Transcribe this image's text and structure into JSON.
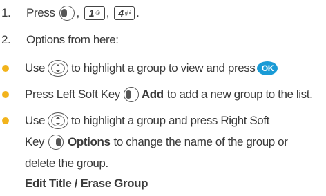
{
  "step1": {
    "number": "1.",
    "press": "Press",
    "sep1": ",",
    "sep2": ",",
    "end": ".",
    "key1": {
      "digit": "1",
      "sub": "@"
    },
    "key2": {
      "digit": "4",
      "sub": "ghi"
    }
  },
  "step2": {
    "number": "2.",
    "text": "Options from here:"
  },
  "bullets": {
    "b1": {
      "pre": "Use",
      "mid": "to highlight a group to view and press",
      "ok_label": "OK"
    },
    "b2": {
      "pre": "Press Left Soft Key",
      "key_label": "Add",
      "post": "to add a new group to the list."
    },
    "b3": {
      "pre": "Use",
      "post": "to highlight a group and press Right Soft",
      "line2_pre": "Key",
      "key_label": "Options",
      "line2_post": "to change the name of the group or",
      "line3": "delete the group.",
      "line4": "Edit Title / Erase Group"
    }
  },
  "colors": {
    "bullet": "#f2b31b",
    "ok_key": "#1a9bd6",
    "text": "#3a3a3a"
  },
  "icons": [
    "left-softkey-icon",
    "nav-key-icon",
    "ok-key-icon",
    "right-softkey-icon",
    "key-1-icon",
    "key-4-icon"
  ]
}
